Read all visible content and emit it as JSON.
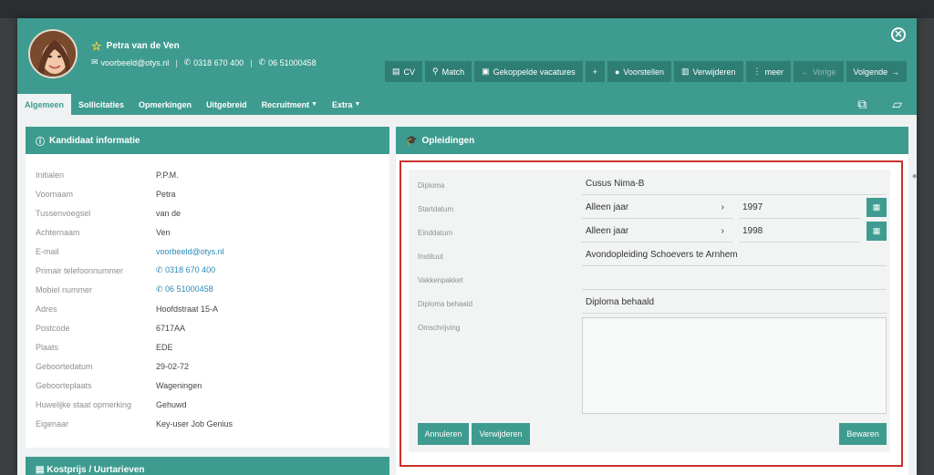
{
  "candidate": {
    "name": "Petra van de Ven",
    "email": "voorbeeld@otys.nl",
    "phone": "0318 670 400",
    "mobile": "06 51000458"
  },
  "toolbar": {
    "cv": "CV",
    "match": "Match",
    "linked": "Gekoppelde vacatures",
    "add": "+",
    "propose": "Voorstellen",
    "delete": "Verwijderen",
    "more": "meer",
    "prev": "Vorige",
    "next": "Volgende"
  },
  "tabs": [
    "Algemeen",
    "Sollicitaties",
    "Opmerkingen",
    "Uitgebreid",
    "Recruitment",
    "Extra"
  ],
  "left_panel": {
    "title": "Kandidaat informatie",
    "rows": [
      {
        "label": "Initialen",
        "value": "P.P.M."
      },
      {
        "label": "Voornaam",
        "value": "Petra"
      },
      {
        "label": "Tussenvoegsel",
        "value": "van de"
      },
      {
        "label": "Achternaam",
        "value": "Ven"
      },
      {
        "label": "E-mail",
        "value": "voorbeeld@otys.nl"
      },
      {
        "label": "Primair telefoonnummer",
        "value": "0318 670 400"
      },
      {
        "label": "Mobiel nummer",
        "value": "06 51000458"
      },
      {
        "label": "Adres",
        "value": "Hoofdstraat 15-A"
      },
      {
        "label": "Postcode",
        "value": "6717AA"
      },
      {
        "label": "Plaats",
        "value": "EDE"
      },
      {
        "label": "Geboortedatum",
        "value": "29-02-72"
      },
      {
        "label": "Geboorteplaats",
        "value": "Wageningen"
      },
      {
        "label": "Huwelijke staat opmerking",
        "value": "Gehuwd"
      },
      {
        "label": "Eigenaar",
        "value": "Key-user Job Genius"
      }
    ],
    "second_title": "Kostprijs / Uurtarieven"
  },
  "right_panel": {
    "title": "Opleidingen",
    "form": {
      "diploma_label": "Diploma",
      "diploma_value": "Cusus Nima-B",
      "start_label": "Startdatum",
      "start_type": "Alleen jaar",
      "start_year": "1997",
      "end_label": "Einddatum",
      "end_type": "Alleen jaar",
      "end_year": "1998",
      "institute_label": "Instituut",
      "institute_value": "Avondopleiding Schoevers te Arnhem",
      "subjects_label": "Vakkenpakket",
      "subjects_value": "",
      "obtained_label": "Diploma behaald",
      "obtained_value": "Diploma behaald",
      "description_label": "Omschrijving",
      "description_value": ""
    },
    "buttons": {
      "cancel": "Annuleren",
      "delete": "Verwijderen",
      "save": "Bewaren"
    }
  },
  "colors": {
    "accent": "#3e9b8f",
    "accent_dark": "#2f7e74",
    "highlight_border": "#c9302c",
    "link": "#2a8ab8"
  }
}
